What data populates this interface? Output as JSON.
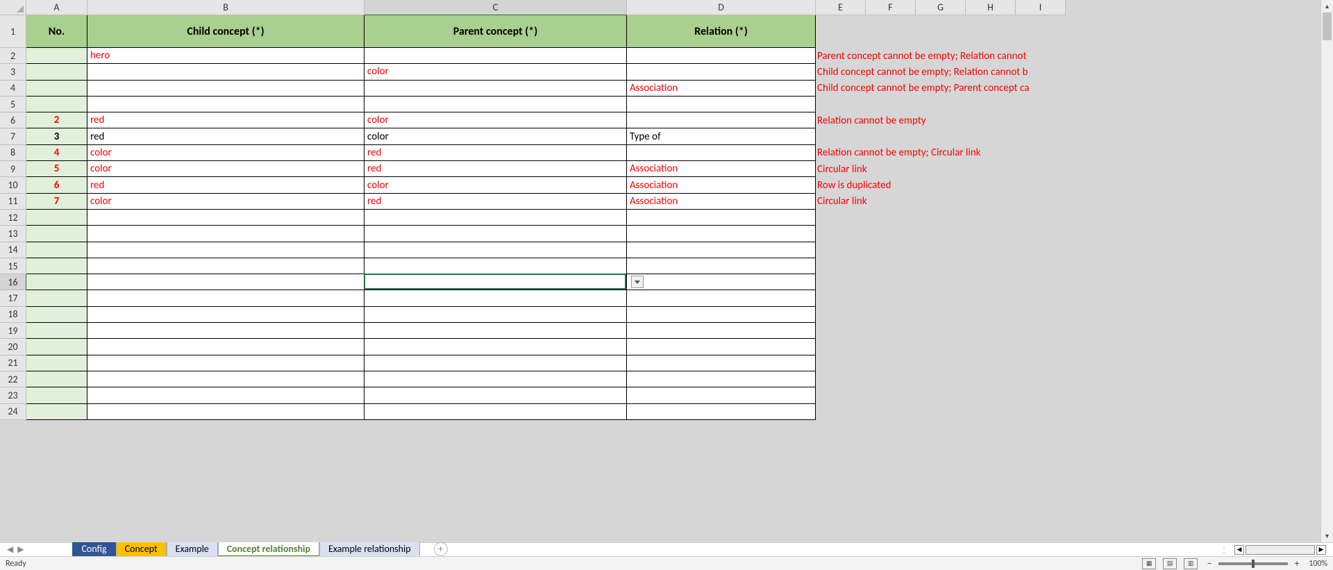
{
  "columns": [
    "A",
    "B",
    "C",
    "D",
    "E",
    "F",
    "G",
    "H",
    "I"
  ],
  "active_col": "C",
  "active_row": 16,
  "headers": {
    "A": "No.",
    "B": "Child concept (*)",
    "C": "Parent concept (*)",
    "D": "Relation (*)"
  },
  "rows": [
    {
      "r": 2,
      "no": "",
      "b": "hero",
      "c": "",
      "d": "",
      "note": "Parent concept cannot be empty; Relation cannot",
      "err": true
    },
    {
      "r": 3,
      "no": "",
      "b": "",
      "c": "color",
      "d": "",
      "note": "Child concept cannot be empty; Relation cannot b",
      "err": true
    },
    {
      "r": 4,
      "no": "",
      "b": "",
      "c": "",
      "d": "Association",
      "note": "Child concept cannot be empty; Parent concept ca",
      "err": true
    },
    {
      "r": 5,
      "no": "",
      "b": "",
      "c": "",
      "d": "",
      "note": "",
      "err": false
    },
    {
      "r": 6,
      "no": "2",
      "b": "red",
      "c": "color",
      "d": "",
      "note": "Relation cannot be empty",
      "err": true
    },
    {
      "r": 7,
      "no": "3",
      "b": "red",
      "c": "color",
      "d": "Type of",
      "note": "",
      "err": false
    },
    {
      "r": 8,
      "no": "4",
      "b": "color",
      "c": "red",
      "d": "",
      "note": "Relation cannot be empty; Circular link",
      "err": true
    },
    {
      "r": 9,
      "no": "5",
      "b": "color",
      "c": "red",
      "d": "Association",
      "note": "Circular link",
      "err": true
    },
    {
      "r": 10,
      "no": "6",
      "b": "red",
      "c": "color",
      "d": "Association",
      "note": "Row is duplicated",
      "err": true
    },
    {
      "r": 11,
      "no": "7",
      "b": "color",
      "c": "red",
      "d": "Association",
      "note": "Circular link",
      "err": true
    },
    {
      "r": 12,
      "no": "",
      "b": "",
      "c": "",
      "d": "",
      "note": "",
      "err": false
    },
    {
      "r": 13,
      "no": "",
      "b": "",
      "c": "",
      "d": "",
      "note": "",
      "err": false
    },
    {
      "r": 14,
      "no": "",
      "b": "",
      "c": "",
      "d": "",
      "note": "",
      "err": false
    },
    {
      "r": 15,
      "no": "",
      "b": "",
      "c": "",
      "d": "",
      "note": "",
      "err": false
    },
    {
      "r": 16,
      "no": "",
      "b": "",
      "c": "",
      "d": "",
      "note": "",
      "err": false
    },
    {
      "r": 17,
      "no": "",
      "b": "",
      "c": "",
      "d": "",
      "note": "",
      "err": false
    },
    {
      "r": 18,
      "no": "",
      "b": "",
      "c": "",
      "d": "",
      "note": "",
      "err": false
    },
    {
      "r": 19,
      "no": "",
      "b": "",
      "c": "",
      "d": "",
      "note": "",
      "err": false
    },
    {
      "r": 20,
      "no": "",
      "b": "",
      "c": "",
      "d": "",
      "note": "",
      "err": false
    },
    {
      "r": 21,
      "no": "",
      "b": "",
      "c": "",
      "d": "",
      "note": "",
      "err": false
    },
    {
      "r": 22,
      "no": "",
      "b": "",
      "c": "",
      "d": "",
      "note": "",
      "err": false
    },
    {
      "r": 23,
      "no": "",
      "b": "",
      "c": "",
      "d": "",
      "note": "",
      "err": false
    },
    {
      "r": 24,
      "no": "",
      "b": "",
      "c": "",
      "d": "",
      "note": "",
      "err": false
    }
  ],
  "tabs": {
    "config": "Config",
    "concept": "Concept",
    "example": "Example",
    "concept_rel": "Concept relationship",
    "example_rel": "Example relationship"
  },
  "status": {
    "ready": "Ready",
    "zoom": "100%"
  }
}
